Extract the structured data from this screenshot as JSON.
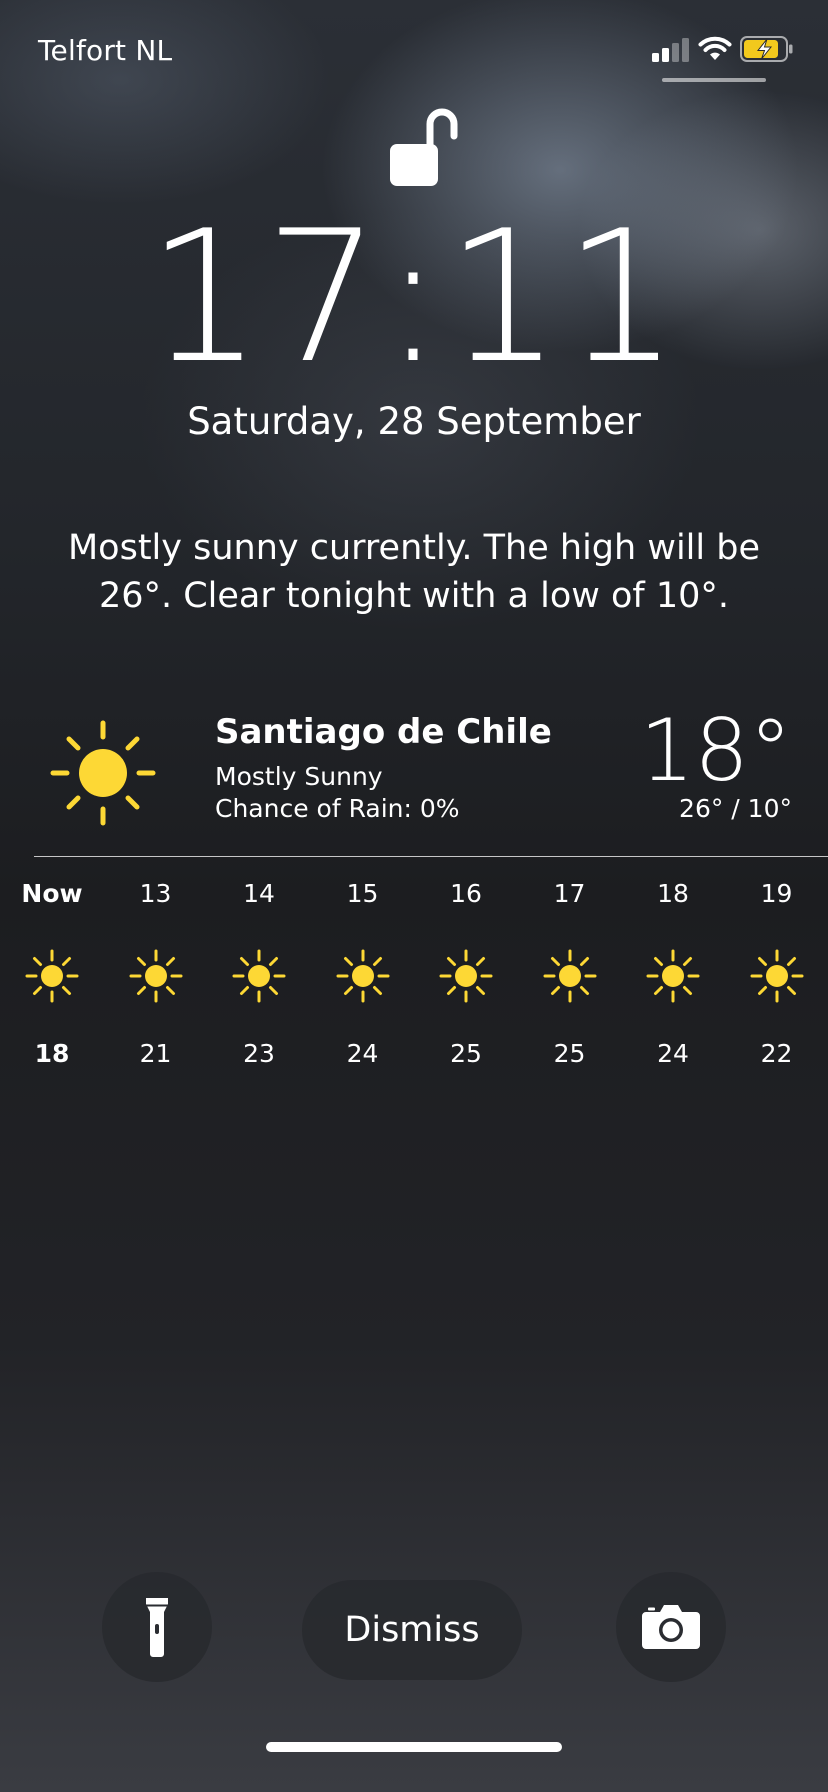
{
  "status_bar": {
    "carrier": "Telfort NL",
    "signal_bars": 2,
    "signal_bars_total": 4,
    "battery_state": "charging",
    "battery_color": "#f2c91d"
  },
  "lock": {
    "icon": "unlocked-padlock-icon",
    "time": "17:11",
    "date": "Saturday, 28 September"
  },
  "weather": {
    "summary": "Mostly sunny currently. The high will be 26°. Clear tonight with a low of 10°.",
    "city": "Santiago de Chile",
    "condition": "Mostly Sunny",
    "rain": "Chance of Rain: 0%",
    "current_temp": "18°",
    "high_low": "26° / 10°",
    "icon": "sun-icon",
    "icon_color": "#fdd835",
    "hourly": [
      {
        "label": "Now",
        "temp": "18",
        "icon": "sun-icon"
      },
      {
        "label": "13",
        "temp": "21",
        "icon": "sun-icon"
      },
      {
        "label": "14",
        "temp": "23",
        "icon": "sun-icon"
      },
      {
        "label": "15",
        "temp": "24",
        "icon": "sun-icon"
      },
      {
        "label": "16",
        "temp": "25",
        "icon": "sun-icon"
      },
      {
        "label": "17",
        "temp": "25",
        "icon": "sun-icon"
      },
      {
        "label": "18",
        "temp": "24",
        "icon": "sun-icon"
      },
      {
        "label": "19",
        "temp": "22",
        "icon": "sun-icon"
      }
    ]
  },
  "controls": {
    "flashlight_icon": "flashlight-icon",
    "dismiss_label": "Dismiss",
    "camera_icon": "camera-icon"
  }
}
